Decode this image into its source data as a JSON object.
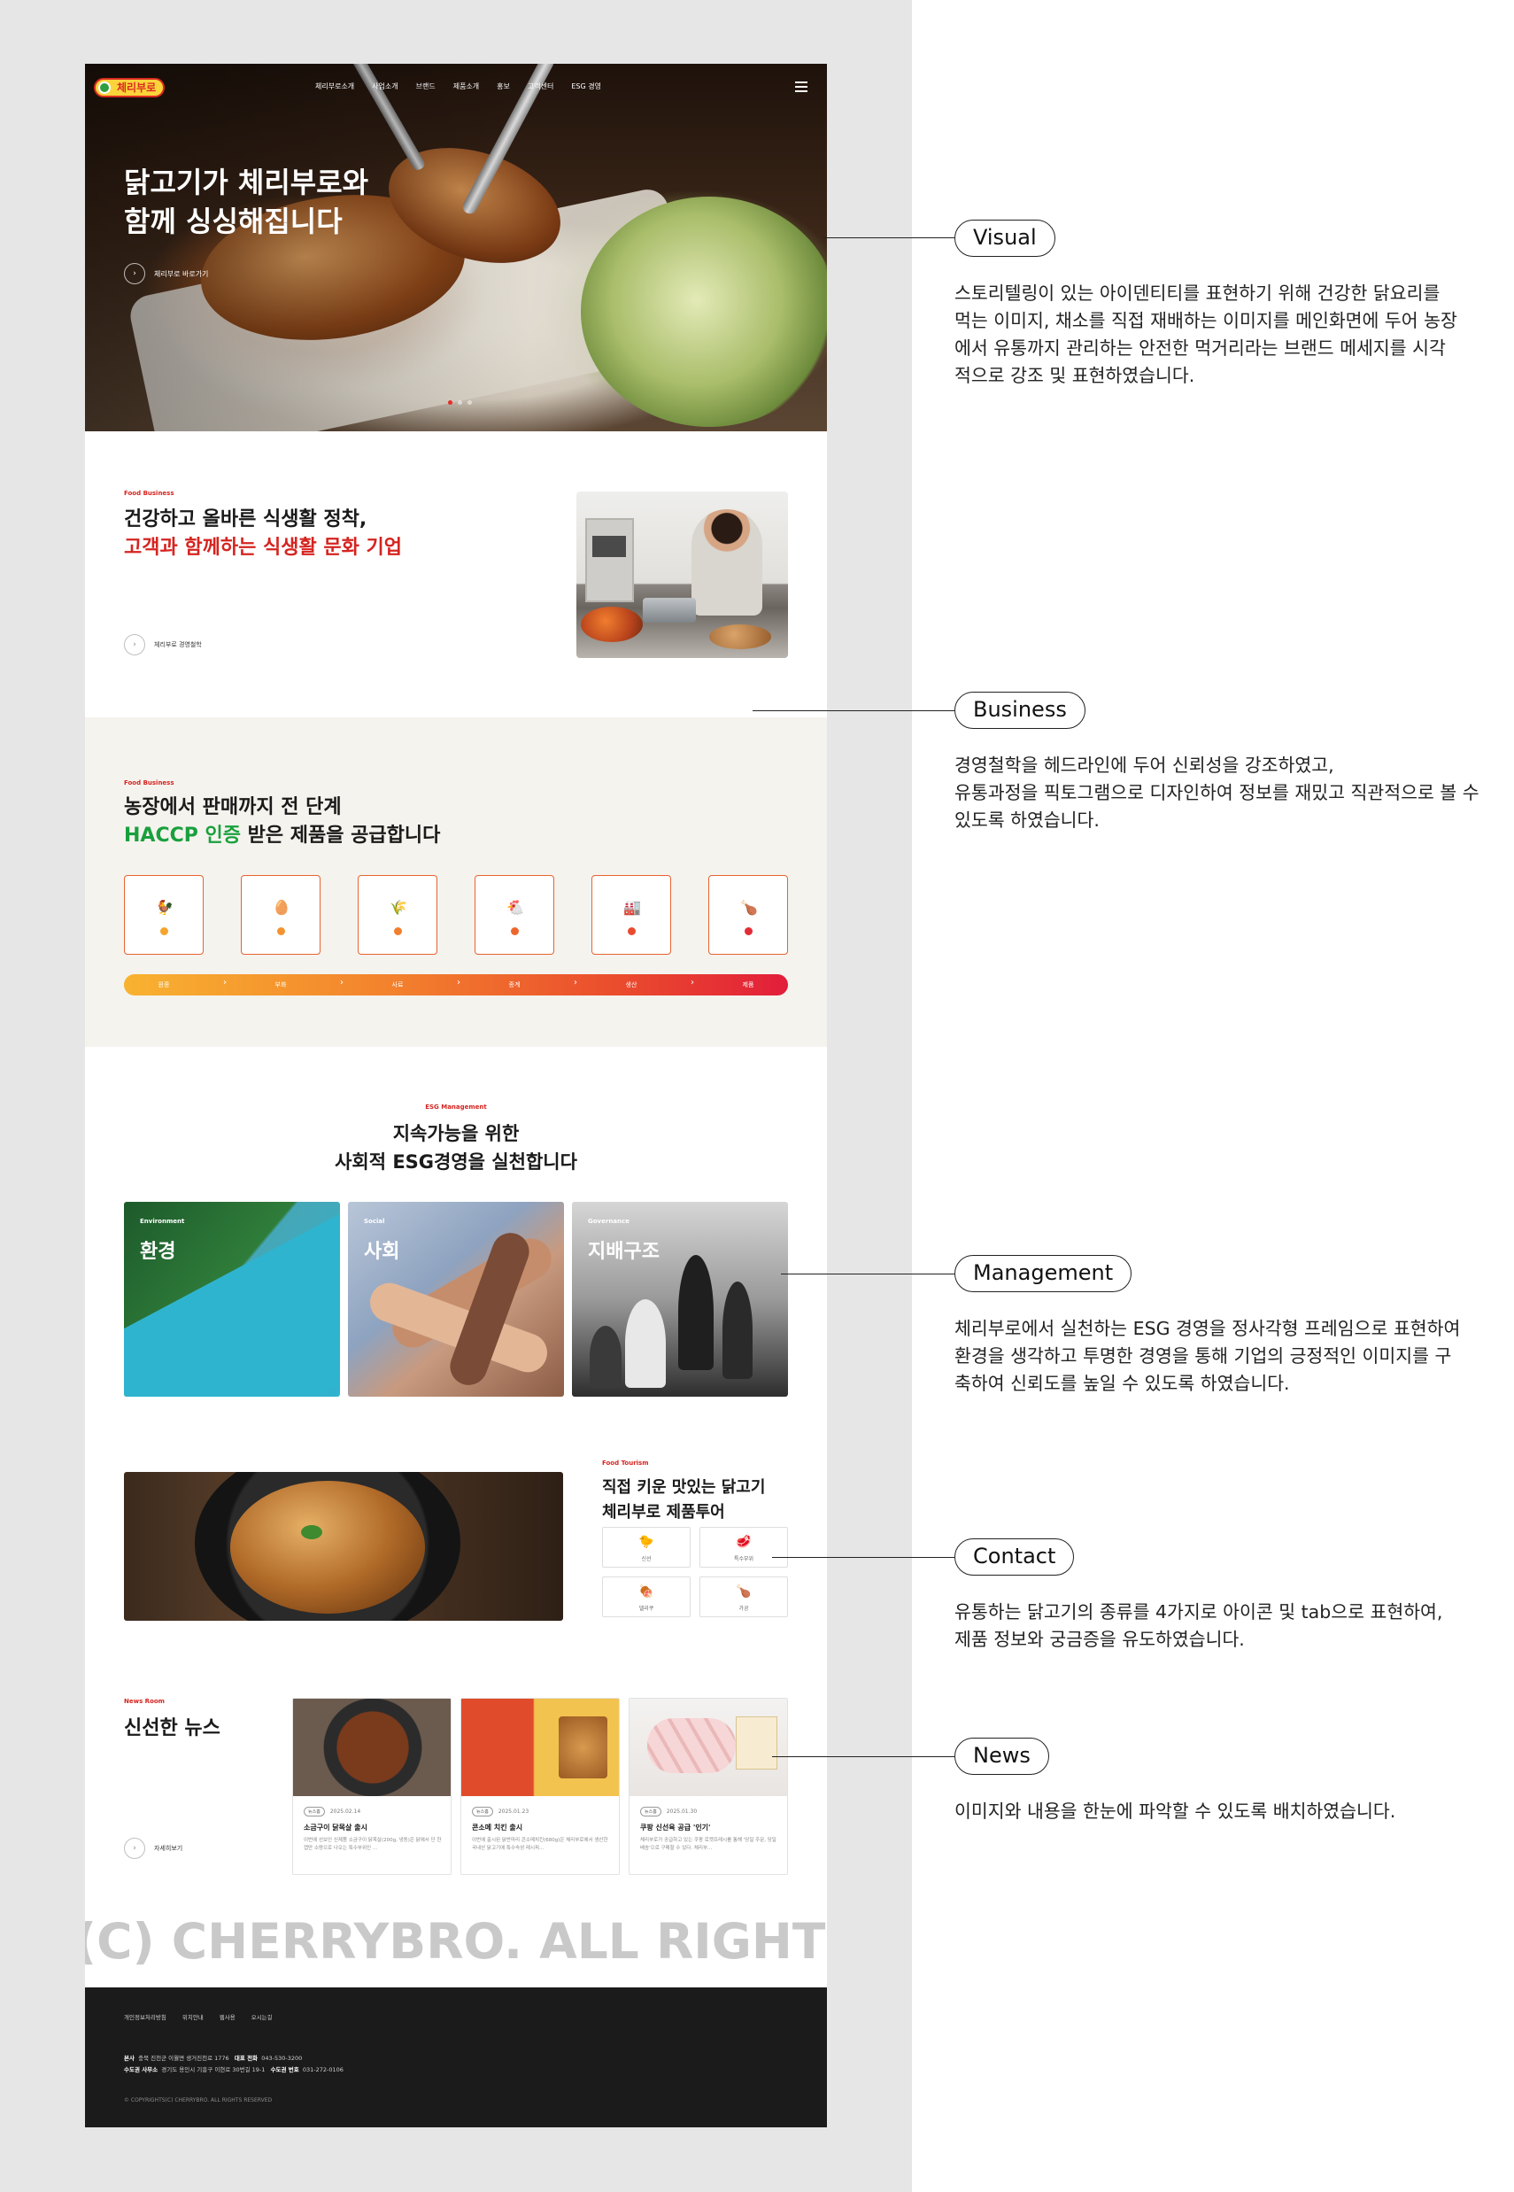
{
  "nav": {
    "logo": "체리부로",
    "menu": [
      "체리부로소개",
      "사업소개",
      "브랜드",
      "제품소개",
      "홍보",
      "고객센터",
      "ESG 경영"
    ]
  },
  "hero": {
    "title_lines": [
      "닭고기가 체리부로와",
      "함께 싱싱해집니다"
    ],
    "button_label": "체리부로 바로가기"
  },
  "business": {
    "eyebrow": "Food Business",
    "line1": "건강하고 올바른 식생활 정착,",
    "line2": "고객과 함께하는 식생활 문화 기업",
    "button_label": "체리부로 경영철학"
  },
  "haccp": {
    "eyebrow": "Food Business",
    "line1": "농장에서 판매까지 전 단계",
    "line2_highlight": "HACCP 인증",
    "line2_rest": " 받은 제품을 공급합니다",
    "steps": [
      "원종",
      "부화",
      "사료",
      "종계",
      "생산",
      "제품"
    ]
  },
  "esg": {
    "eyebrow": "ESG Management",
    "line1": "지속가능을 위한",
    "line2": "사회적 ESG경영을 실천합니다",
    "cards": [
      {
        "eyebrow": "Environment",
        "title": "환경"
      },
      {
        "eyebrow": "Social",
        "title": "사회"
      },
      {
        "eyebrow": "Governance",
        "title": "지배구조"
      }
    ]
  },
  "tour": {
    "eyebrow": "Food Tourism",
    "line1": "직접 키운 맛있는 닭고기",
    "line2": "체리부로 제품투어",
    "tabs": [
      "신선",
      "특수부위",
      "델리쿠",
      "가공"
    ]
  },
  "news": {
    "eyebrow": "News Room",
    "title": "신선한 뉴스",
    "more_label": "자세히보기",
    "items": [
      {
        "badge": "뉴스홈",
        "date": "2025.02.14",
        "title": "소금구이 닭목살 출시",
        "desc": "이번에 선보인 신제품 소금구이 닭목살(200g, 냉동)은 닭에서 단 한 캡만 소량으로 나오는 특수부위인 ..."
      },
      {
        "badge": "뉴스홈",
        "date": "2025.01.23",
        "title": "콘소메 치킨 출시",
        "desc": "이번에 출시된 닭반마리 콘소메치킨(680g)은 체리부로에서 생산한 국내산 닭고기에 특수숙성 레시피..."
      },
      {
        "badge": "뉴스홈",
        "date": "2025.01.30",
        "title": "쿠팡 신선육 공급 '인기'",
        "desc": "체리부로가 공급하고 있는 쿠팡 로켓프레시를 통해 '당일 주문, 당일 배송'으로 구매할 수 있다. 체리부..."
      }
    ]
  },
  "watermark": "(C) CHERRYBRO. ALL RIGHTS RESERVED",
  "footer": {
    "links": [
      "개인정보처리방침",
      "위치안내",
      "웹사용",
      "오시는길"
    ],
    "hq_label": "본사",
    "hq_addr": "충북 진천군 이월면 생거진천로 1776",
    "hq_tel_label": "대표 전화",
    "hq_tel": "043-530-3200",
    "seoul_label": "수도권 사무소",
    "seoul_addr": "경기도 용인시 기흥구 이현로 30번길 19-1",
    "seoul_tel_label": "수도권 번호",
    "seoul_tel": "031-272-0106",
    "copyright": "© COPYRIGHTS(C) CHERRYBRO. ALL RIGHTS RESERVED"
  },
  "annotations": [
    {
      "label": "Visual",
      "lines": [
        "스토리텔링이 있는 아이덴티티를 표현하기 위해 건강한 닭요리를",
        "먹는 이미지, 채소를 직접 재배하는 이미지를 메인화면에 두어 농장",
        "에서 유통까지 관리하는 안전한 먹거리라는 브랜드 메세지를 시각",
        "적으로 강조 및 표현하였습니다."
      ]
    },
    {
      "label": "Business",
      "lines": [
        "경영철학을 헤드라인에 두어 신뢰성을 강조하였고,",
        "유통과정을 픽토그램으로 디자인하여 정보를 재밌고 직관적으로 볼 수",
        "있도록 하였습니다."
      ]
    },
    {
      "label": "Management",
      "lines": [
        "체리부로에서 실천하는 ESG 경영을 정사각형 프레임으로 표현하여",
        "환경을 생각하고 투명한 경영을 통해 기업의 긍정적인 이미지를 구",
        "축하여 신뢰도를 높일 수 있도록 하였습니다."
      ]
    },
    {
      "label": "Contact",
      "lines": [
        "유통하는 닭고기의 종류를 4가지로 아이콘 및 tab으로 표현하여,",
        "제품 정보와 궁금증을 유도하였습니다."
      ]
    },
    {
      "label": "News",
      "lines": [
        "이미지와 내용을 한눈에 파악할 수 있도록 배치하였습니다."
      ]
    }
  ]
}
